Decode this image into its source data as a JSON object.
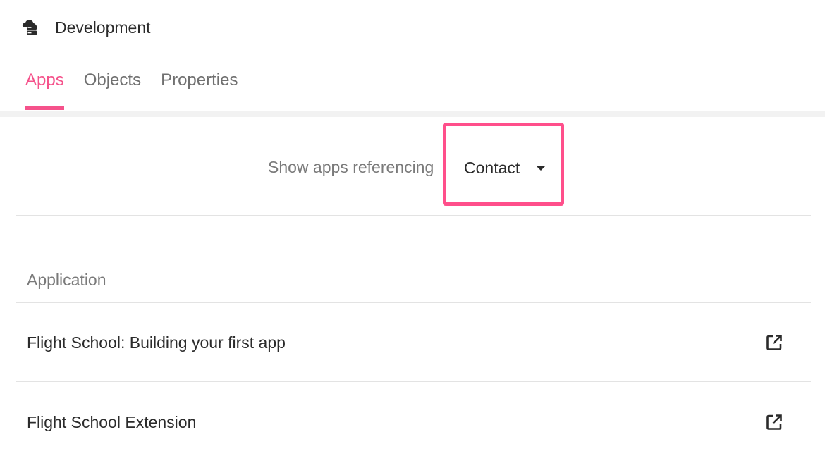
{
  "header": {
    "env_icon": "cloud-server-icon",
    "title": "Development"
  },
  "tabs": [
    {
      "label": "Apps",
      "active": true
    },
    {
      "label": "Objects",
      "active": false
    },
    {
      "label": "Properties",
      "active": false
    }
  ],
  "filter": {
    "label": "Show apps referencing",
    "selected": "Contact",
    "caret_icon": "caret-down-icon",
    "highlight_color": "#ff4f8b"
  },
  "table": {
    "column_header": "Application",
    "rows": [
      {
        "name": "Flight School: Building your first app",
        "action_icon": "external-link-icon"
      },
      {
        "name": "Flight School Extension",
        "action_icon": "external-link-icon"
      }
    ]
  },
  "colors": {
    "accent": "#f5528b",
    "text": "#2b2b2b",
    "muted": "#7a7a7a"
  }
}
